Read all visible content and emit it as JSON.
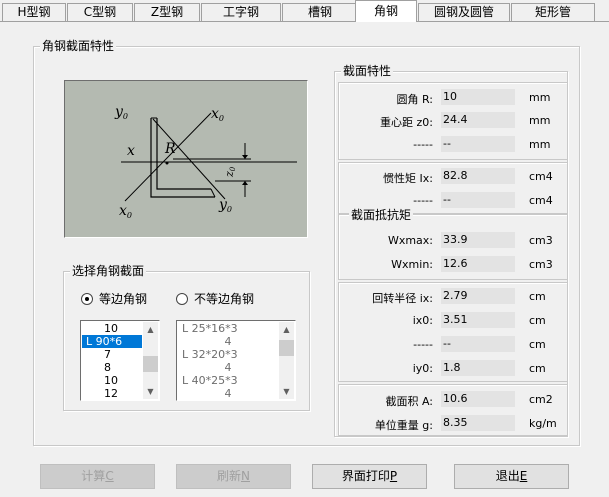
{
  "tabs": [
    {
      "label": "H型钢"
    },
    {
      "label": "C型钢"
    },
    {
      "label": "Z型钢"
    },
    {
      "label": "工字钢"
    },
    {
      "label": "槽钢"
    },
    {
      "label": "角钢"
    },
    {
      "label": "圆钢及圆管"
    },
    {
      "label": "矩形管"
    }
  ],
  "section_group_title": "角钢截面特性",
  "diagram": {
    "labels": {
      "y0_top": "y",
      "x0_top": "x",
      "x_left": "x",
      "R": "R",
      "z0": "z",
      "x0_bottom": "x",
      "y0_bottom": "y",
      "sub": "0"
    }
  },
  "select_group": {
    "title": "选择角钢截面",
    "radio_equal": "等边角钢",
    "radio_unequal": "不等边角钢",
    "selected": "equal",
    "equal_list": [
      "10",
      "L 90*6",
      "7",
      "8",
      "10",
      "12"
    ],
    "equal_selected_index": 1,
    "unequal_list": [
      "L 25*16*3",
      "4",
      "L 32*20*3",
      "4",
      "L 40*25*3",
      "4"
    ]
  },
  "props": {
    "title": "截面特性",
    "R": {
      "label": "圆角    R:",
      "value": "10",
      "unit": "mm"
    },
    "z0": {
      "label": "重心距 z0:",
      "value": "24.4",
      "unit": "mm"
    },
    "dash1": {
      "label": "-----",
      "value": "--",
      "unit": "mm"
    },
    "Ix": {
      "label": "惯性矩 Ix:",
      "value": "82.8",
      "unit": "cm4"
    },
    "dash2": {
      "label": "-----",
      "value": "--",
      "unit": "cm4"
    },
    "resist_title": "截面抵抗矩",
    "Wxmax": {
      "label": "Wxmax:",
      "value": "33.9",
      "unit": "cm3"
    },
    "Wxmin": {
      "label": "Wxmin:",
      "value": "12.6",
      "unit": "cm3"
    },
    "ix": {
      "label": "回转半径 ix:",
      "value": "2.79",
      "unit": "cm"
    },
    "ix0": {
      "label": "ix0:",
      "value": "3.51",
      "unit": "cm"
    },
    "dash3": {
      "label": "-----",
      "value": "--",
      "unit": "cm"
    },
    "iy0": {
      "label": "iy0:",
      "value": "1.8",
      "unit": "cm"
    },
    "A": {
      "label": "截面积 A:",
      "value": "10.6",
      "unit": "cm2"
    },
    "g": {
      "label": "单位重量 g:",
      "value": "8.35",
      "unit": "kg/m"
    }
  },
  "buttons": {
    "calc": {
      "label": "计算",
      "key": "C"
    },
    "refresh": {
      "label": "刷新",
      "key": "N"
    },
    "print": {
      "label": "界面打印",
      "key": "P"
    },
    "exit": {
      "label": "退出",
      "key": "E"
    }
  }
}
